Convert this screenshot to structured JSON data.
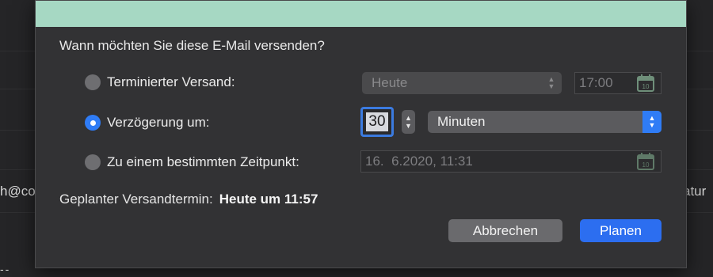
{
  "background": {
    "left_text": "h@co",
    "right_text": "atur",
    "bottom_dash": "--"
  },
  "dialog": {
    "accent_color": "#a6d8c3",
    "prompt": "Wann möchten Sie diese E-Mail versenden?",
    "options": [
      {
        "label": "Terminierter Versand:",
        "selected": false
      },
      {
        "label": "Verzögerung um:",
        "selected": true
      },
      {
        "label": "Zu einem bestimmten Zeitpunkt:",
        "selected": false
      }
    ],
    "scheduled": {
      "day_value": "Heute",
      "time_value": "17:00"
    },
    "delay": {
      "amount": "30",
      "unit": "Minuten"
    },
    "specific": {
      "datetime_value": "16.  6.2020, 11:31"
    },
    "summary_label": "Geplanter Versandtermin:",
    "summary_value": "Heute um 11:57",
    "cancel_label": "Abbrechen",
    "confirm_label": "Planen",
    "colors": {
      "selected_radio": "#2f7cf6",
      "primary_button": "#2c6ef0"
    },
    "icons": {
      "calendar": "calendar-icon",
      "stepper": "up-down-chevron-icon"
    }
  }
}
